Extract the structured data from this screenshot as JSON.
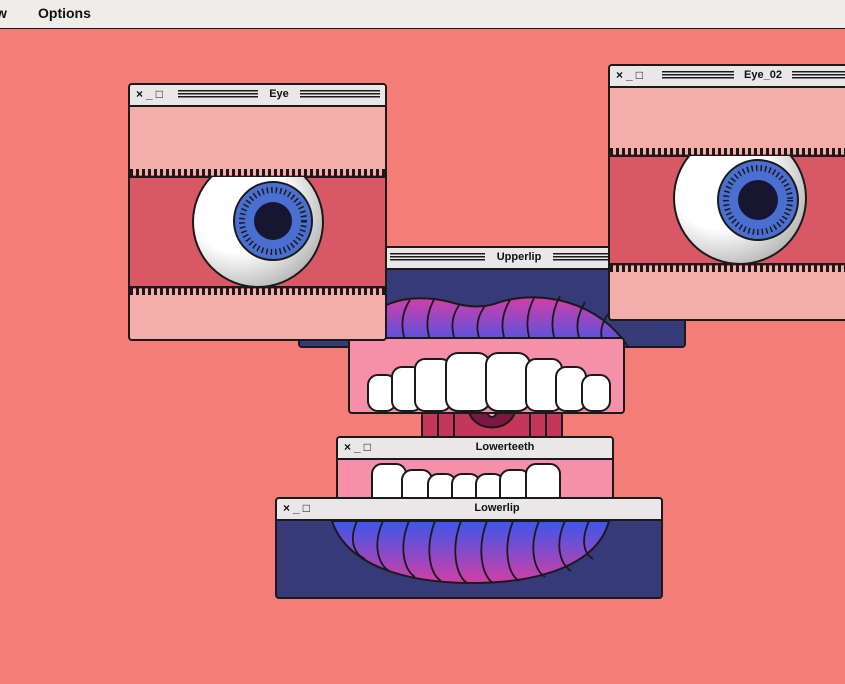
{
  "menubar": {
    "items": [
      "w",
      "Options"
    ]
  },
  "window_controls": {
    "close": "×",
    "minimize": "_",
    "maximize": "□"
  },
  "windows": {
    "eye": {
      "title": "Eye"
    },
    "eye_02": {
      "title": "Eye_02"
    },
    "upperlip": {
      "title": "Upperlip"
    },
    "lowerteeth": {
      "title": "Lowerteeth"
    },
    "lowerlip": {
      "title": "Lowerlip"
    }
  },
  "colors": {
    "background": "#f47d77",
    "eye_band": "#d95866",
    "eye_lid": "#f3aeaa",
    "iris": "#4b6fd1",
    "pupil": "#161630",
    "navy": "#363a78",
    "gum_pink": "#f590a8",
    "lip_gradient": [
      "#3b57ea",
      "#d43ea6"
    ]
  },
  "icons": [
    "close-icon",
    "minimize-icon",
    "maximize-icon"
  ]
}
